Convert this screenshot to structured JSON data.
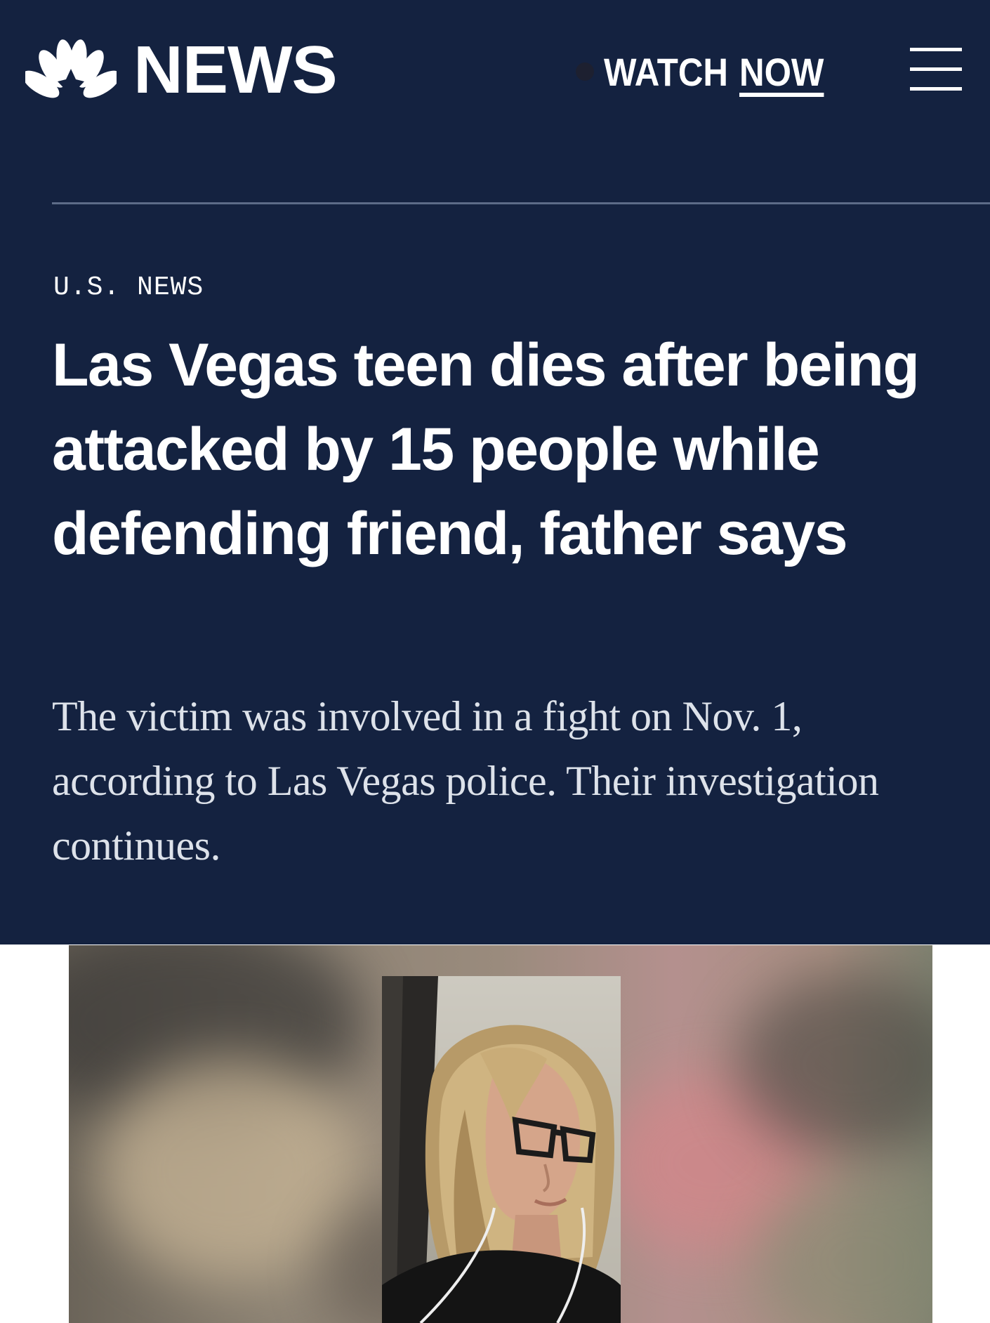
{
  "header": {
    "logo_text": "NEWS",
    "logo_icon": "peacock-icon",
    "watch_label_part1": "WATCH",
    "watch_label_part2": "NOW",
    "menu_icon": "hamburger-menu-icon"
  },
  "article": {
    "section": "U.S. NEWS",
    "headline": "Las Vegas teen dies after being attacked by 15 people while defending friend, father says",
    "dek": "The victim was involved in a fight on Nov. 1, according to Las Vegas police. Their investigation continues."
  },
  "colors": {
    "header_background": "#142240",
    "text": "#ffffff",
    "divider": "#5d6c88"
  }
}
